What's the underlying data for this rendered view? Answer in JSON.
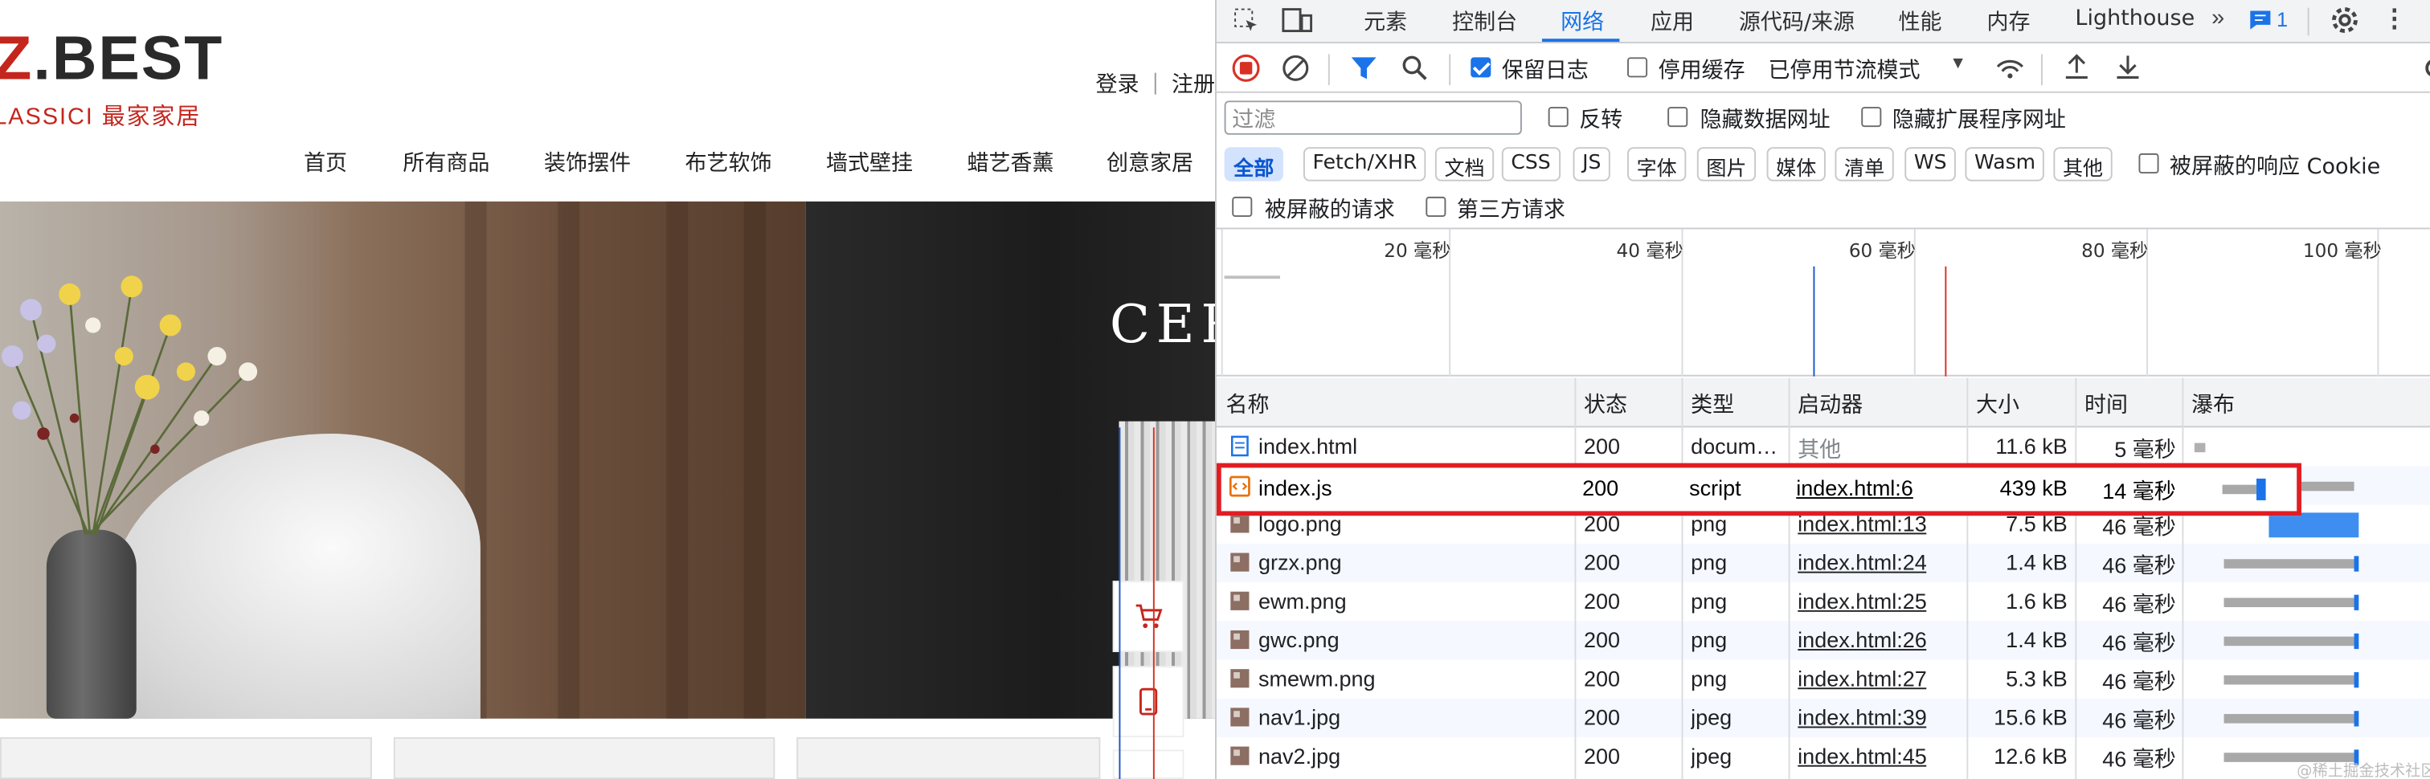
{
  "site": {
    "logo_text": "Z.BEST",
    "logo_sub": "LASSICI 最家家居",
    "login": "登录",
    "register": "注册",
    "nav": [
      "首页",
      "所有商品",
      "装饰摆件",
      "布艺软饰",
      "墙式壁挂",
      "蜡艺香薰",
      "创意家居"
    ],
    "hero_text": "CER"
  },
  "devtools": {
    "tabs": [
      "元素",
      "控制台",
      "网络",
      "应用",
      "源代码/来源",
      "性能",
      "内存",
      "Lighthouse"
    ],
    "active_tab": "网络",
    "issues_count": "1",
    "toolbar": {
      "preserve_log": "保留日志",
      "disable_cache": "停用缓存",
      "throttle": "已停用节流模式"
    },
    "filter": {
      "placeholder": "过滤",
      "invert": "反转",
      "hide_data_urls": "隐藏数据网址",
      "hide_extension_urls": "隐藏扩展程序网址"
    },
    "type_filters": [
      "全部",
      "Fetch/XHR",
      "文档",
      "CSS",
      "JS",
      "字体",
      "图片",
      "媒体",
      "清单",
      "WS",
      "Wasm",
      "其他"
    ],
    "blocked_cookies": "被屏蔽的响应 Cookie",
    "blocked_requests": "被屏蔽的请求",
    "third_party": "第三方请求",
    "overview_ticks": [
      "20 毫秒",
      "40 毫秒",
      "60 毫秒",
      "80 毫秒",
      "100 毫秒"
    ],
    "columns": [
      "名称",
      "状态",
      "类型",
      "启动器",
      "大小",
      "时间",
      "瀑布"
    ],
    "rows": [
      {
        "name": "index.html",
        "status": "200",
        "type": "docum…",
        "initiator": "其他",
        "size": "11.6 kB",
        "time": "5 毫秒",
        "icon": "document-icon"
      },
      {
        "name": "index.js",
        "status": "200",
        "type": "script",
        "initiator": "index.html:6",
        "size": "439 kB",
        "time": "14 毫秒",
        "icon": "script-icon"
      },
      {
        "name": "logo.png",
        "status": "200",
        "type": "png",
        "initiator": "index.html:13",
        "size": "7.5 kB",
        "time": "46 毫秒",
        "icon": "image-icon"
      },
      {
        "name": "grzx.png",
        "status": "200",
        "type": "png",
        "initiator": "index.html:24",
        "size": "1.4 kB",
        "time": "46 毫秒",
        "icon": "image-icon"
      },
      {
        "name": "ewm.png",
        "status": "200",
        "type": "png",
        "initiator": "index.html:25",
        "size": "1.6 kB",
        "time": "46 毫秒",
        "icon": "image-icon"
      },
      {
        "name": "gwc.png",
        "status": "200",
        "type": "png",
        "initiator": "index.html:26",
        "size": "1.4 kB",
        "time": "46 毫秒",
        "icon": "image-icon"
      },
      {
        "name": "smewm.png",
        "status": "200",
        "type": "png",
        "initiator": "index.html:27",
        "size": "5.3 kB",
        "time": "46 毫秒",
        "icon": "image-icon"
      },
      {
        "name": "nav1.jpg",
        "status": "200",
        "type": "jpeg",
        "initiator": "index.html:39",
        "size": "15.6 kB",
        "time": "46 毫秒",
        "icon": "image-icon"
      },
      {
        "name": "nav2.jpg",
        "status": "200",
        "type": "jpeg",
        "initiator": "index.html:45",
        "size": "12.6 kB",
        "time": "46 毫秒",
        "icon": "image-icon"
      }
    ],
    "colors": {
      "accent": "#1a73e8",
      "highlight": "#e11d24",
      "record": "#d93025"
    }
  },
  "watermark": "@稀土掘金技术社区"
}
